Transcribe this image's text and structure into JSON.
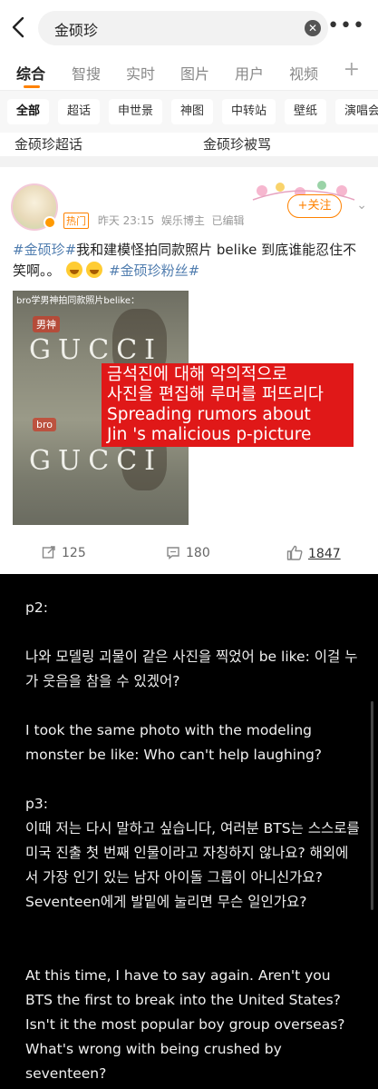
{
  "search": {
    "query": "金硕珍",
    "more": "•••"
  },
  "tabs": [
    {
      "label": "综合"
    },
    {
      "label": "智搜"
    },
    {
      "label": "实时"
    },
    {
      "label": "图片"
    },
    {
      "label": "用户"
    },
    {
      "label": "视频"
    }
  ],
  "tab_plus": "+",
  "filters": [
    "全部",
    "超话",
    "申世景",
    "神图",
    "中转站",
    "壁纸",
    "演唱会"
  ],
  "related": {
    "link1": "金硕珍超话",
    "link2": "金硕珍被骂"
  },
  "post": {
    "hot_tag": "热门",
    "time": "昨天 23:15",
    "tag": "娱乐博主",
    "edited": "已编辑",
    "follow": "+关注",
    "hashtag1": "#金硕珍#",
    "text": "我和建模怪拍同款照片 belike 到底谁能忍住不笑啊。。",
    "hashtag2": "#金硕珍粉丝#",
    "image": {
      "caption": "bro学男神拍同款照片belike：",
      "label_top": "男神",
      "label_bottom": "bro",
      "brand": "GUCCI"
    },
    "overlay": [
      "금석진에 대해 악의적으로",
      "사진을 편집해 루머를 퍼뜨리다",
      "Spreading rumors about",
      "Jin 's malicious p-picture"
    ],
    "reposts": "125",
    "comments": "180",
    "likes": "1847"
  },
  "translation": {
    "p2_heading": "p2:",
    "p2_korean": "나와 모델링 괴물이 같은 사진을 찍었어 be like: 이걸 누가 웃음을 참을 수 있겠어?",
    "p2_english": "I took the same photo with the modeling monster be like: Who can't help laughing?",
    "p3_heading": "p3:",
    "p3_korean": "이때 저는 다시 말하고 싶습니다, 여러분 BTS는 스스로를 미국 진출 첫 번째 인물이라고 자칭하지 않나요? 해외에서 가장 인기 있는 남자 아이돌 그룹이 아니신가요? Seventeen에게 발밑에 눌리면 무슨 일인가요?",
    "p3_english": "At this time, I have to say again. Aren't you BTS the first to break into the United States? Isn't it the most popular boy group overseas? What's wrong with being crushed by seventeen?"
  },
  "colors": {
    "accent": "#ff8200",
    "hashtag": "#507daf",
    "overlay": "#e01818"
  }
}
